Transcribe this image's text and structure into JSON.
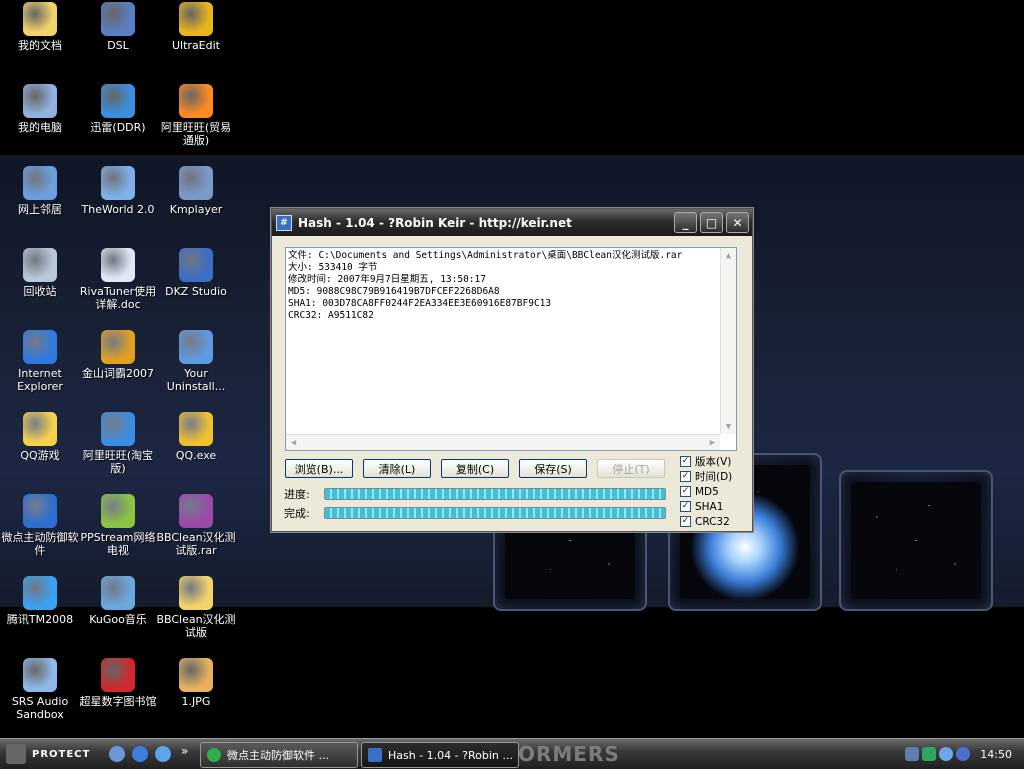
{
  "desktop": {
    "icons": [
      {
        "label": "我的文档",
        "icon": "folder-icon",
        "color": "#f2d36b"
      },
      {
        "label": "DSL",
        "icon": "network-computer-icon",
        "color": "#5a7fc4"
      },
      {
        "label": "UltraEdit",
        "icon": "ultraedit-icon",
        "color": "#e7b51c"
      },
      {
        "label": "我的电脑",
        "icon": "computer-icon",
        "color": "#8fb1e0"
      },
      {
        "label": "迅雷(DDR)",
        "icon": "thunder-icon",
        "color": "#3a8fe0"
      },
      {
        "label": "阿里旺旺(贸易通版)",
        "icon": "aliwangwang-icon",
        "color": "#ff8a1f"
      },
      {
        "label": "网上邻居",
        "icon": "network-places-icon",
        "color": "#6c9ee0"
      },
      {
        "label": "TheWorld 2.0",
        "icon": "globe-icon",
        "color": "#7fb0e8"
      },
      {
        "label": "Kmplayer",
        "icon": "kmplayer-icon",
        "color": "#7a9ac8"
      },
      {
        "label": "回收站",
        "icon": "recycle-bin-icon",
        "color": "#b8c8da"
      },
      {
        "label": "RivaTuner使用详解.doc",
        "icon": "word-document-icon",
        "color": "#e0e8f5"
      },
      {
        "label": "DKZ Studio",
        "icon": "dkz-studio-icon",
        "color": "#3b6ec5"
      },
      {
        "label": "Internet Explorer",
        "icon": "ie-icon",
        "color": "#2f7ae0"
      },
      {
        "label": "金山词霸2007",
        "icon": "dictionary-icon",
        "color": "#e0a020"
      },
      {
        "label": "Your Uninstall...",
        "icon": "trash-bin-icon",
        "color": "#5e9ae0"
      },
      {
        "label": "QQ游戏",
        "icon": "qq-game-icon",
        "color": "#f5d24a"
      },
      {
        "label": "阿里旺旺(淘宝版)",
        "icon": "taobao-wangwang-icon",
        "color": "#3a8de0"
      },
      {
        "label": "QQ.exe",
        "icon": "qq-penguin-icon",
        "color": "#f0c030"
      },
      {
        "label": "微点主动防御软件",
        "icon": "micropoint-icon",
        "color": "#2c6fd0"
      },
      {
        "label": "PPStream网络电视",
        "icon": "ppstream-icon",
        "color": "#8ac440"
      },
      {
        "label": "BBClean汉化测试版.rar",
        "icon": "rar-archive-icon",
        "color": "#9b4aa8"
      },
      {
        "label": "腾讯TM2008",
        "icon": "tm2008-icon",
        "color": "#3aa0f0"
      },
      {
        "label": "KuGoo音乐",
        "icon": "kugoo-icon",
        "color": "#6aa8e0"
      },
      {
        "label": "BBClean汉化测试版",
        "icon": "folder-icon",
        "color": "#f2d36b"
      },
      {
        "label": "SRS Audio Sandbox",
        "icon": "srs-audio-icon",
        "color": "#8fb8e8"
      },
      {
        "label": "超星数字图书馆",
        "icon": "superstar-library-icon",
        "color": "#d0282c"
      },
      {
        "label": "1.JPG",
        "icon": "image-file-icon",
        "color": "#e8b060"
      }
    ]
  },
  "window": {
    "title": "Hash - 1.04 - ?Robin Keir - http://keir.net",
    "output_lines": [
      "文件: C:\\Documents and Settings\\Administrator\\桌面\\BBClean汉化测试版.rar",
      "大小: 533410 字节",
      "修改时间: 2007年9月7日星期五, 13:50:17",
      "MD5: 9088C98C79B916419B7DFCEF2268D6A8",
      "SHA1: 003D78CA8FF0244F2EA334EE3E60916E87BF9C13",
      "CRC32: A9511C82"
    ],
    "buttons": {
      "browse": "浏览(B)...",
      "clear": "清除(L)",
      "copy": "复制(C)",
      "save": "保存(S)",
      "stop": "停止(T)"
    },
    "progress_label": "进度:",
    "complete_label": "完成:",
    "progress_value": 1.0,
    "complete_value": 1.0,
    "options": [
      {
        "label": "版本(V)",
        "checked": true
      },
      {
        "label": "时间(D)",
        "checked": true
      },
      {
        "label": "MD5",
        "checked": true
      },
      {
        "label": "SHA1",
        "checked": true
      },
      {
        "label": "CRC32",
        "checked": true
      }
    ]
  },
  "taskbar": {
    "start_label": "PROTECT",
    "tasks": [
      {
        "label": "微点主动防御软件 ...",
        "active": false
      },
      {
        "label": "Hash - 1.04 - ?Robin ...",
        "active": true
      }
    ],
    "decoration": "ORMERS",
    "clock": "14:50",
    "chevron": "»"
  }
}
